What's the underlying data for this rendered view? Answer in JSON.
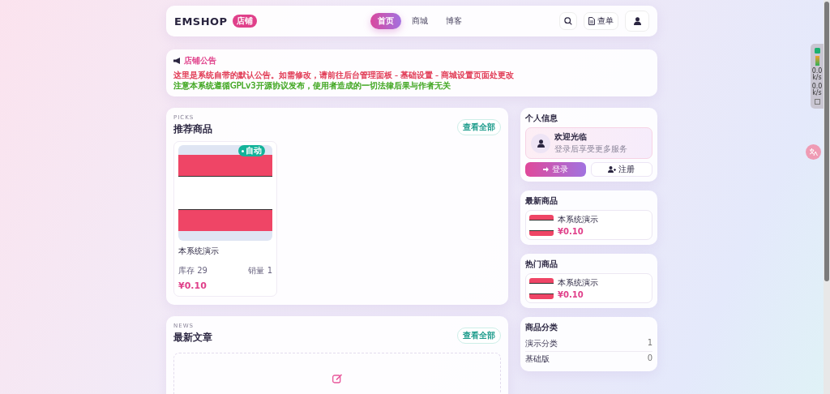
{
  "header": {
    "logo": "EMSHOP",
    "badge": "店铺",
    "nav": [
      {
        "label": "首页",
        "selected": true
      },
      {
        "label": "商城",
        "selected": false
      },
      {
        "label": "博客",
        "selected": false
      }
    ],
    "orders": "查单"
  },
  "notice": {
    "title": "店铺公告",
    "lines": [
      {
        "text": "这里是系统自带的默认公告。如需修改，请前往后台管理面板 - 基础设置 - 商城设置页面处更改",
        "color": "#e0344f"
      },
      {
        "text": "注意本系统遵循GPLv3开源协议发布，使用者造成的一切法律后果与作者无关",
        "color": "#3aa41a"
      }
    ]
  },
  "picks": {
    "eyebrow": "PICKS",
    "title": "推荐商品",
    "more": "查看全部",
    "products": [
      {
        "name": "本系统演示",
        "badge": "自动",
        "stock": "库存 29",
        "sales": "销量 1",
        "price": "¥0.10"
      }
    ]
  },
  "news": {
    "eyebrow": "NEWS",
    "title": "最新文章",
    "more": "查看全部"
  },
  "profile": {
    "title": "个人信息",
    "welcome": "欢迎光临",
    "hint": "登录后享受更多服务",
    "login": "登录",
    "register": "注册"
  },
  "latest": {
    "title": "最新商品",
    "items": [
      {
        "name": "本系统演示",
        "price": "¥0.10"
      }
    ]
  },
  "hot": {
    "title": "热门商品",
    "items": [
      {
        "name": "本系统演示",
        "price": "¥0.10"
      }
    ]
  },
  "categories": {
    "title": "商品分类",
    "items": [
      {
        "name": "演示分类",
        "count": "1"
      },
      {
        "name": "基础版",
        "count": "0"
      }
    ]
  },
  "speed": [
    {
      "value": "0.0",
      "unit": "k/s"
    },
    {
      "value": "0.0",
      "unit": "k/s"
    }
  ]
}
